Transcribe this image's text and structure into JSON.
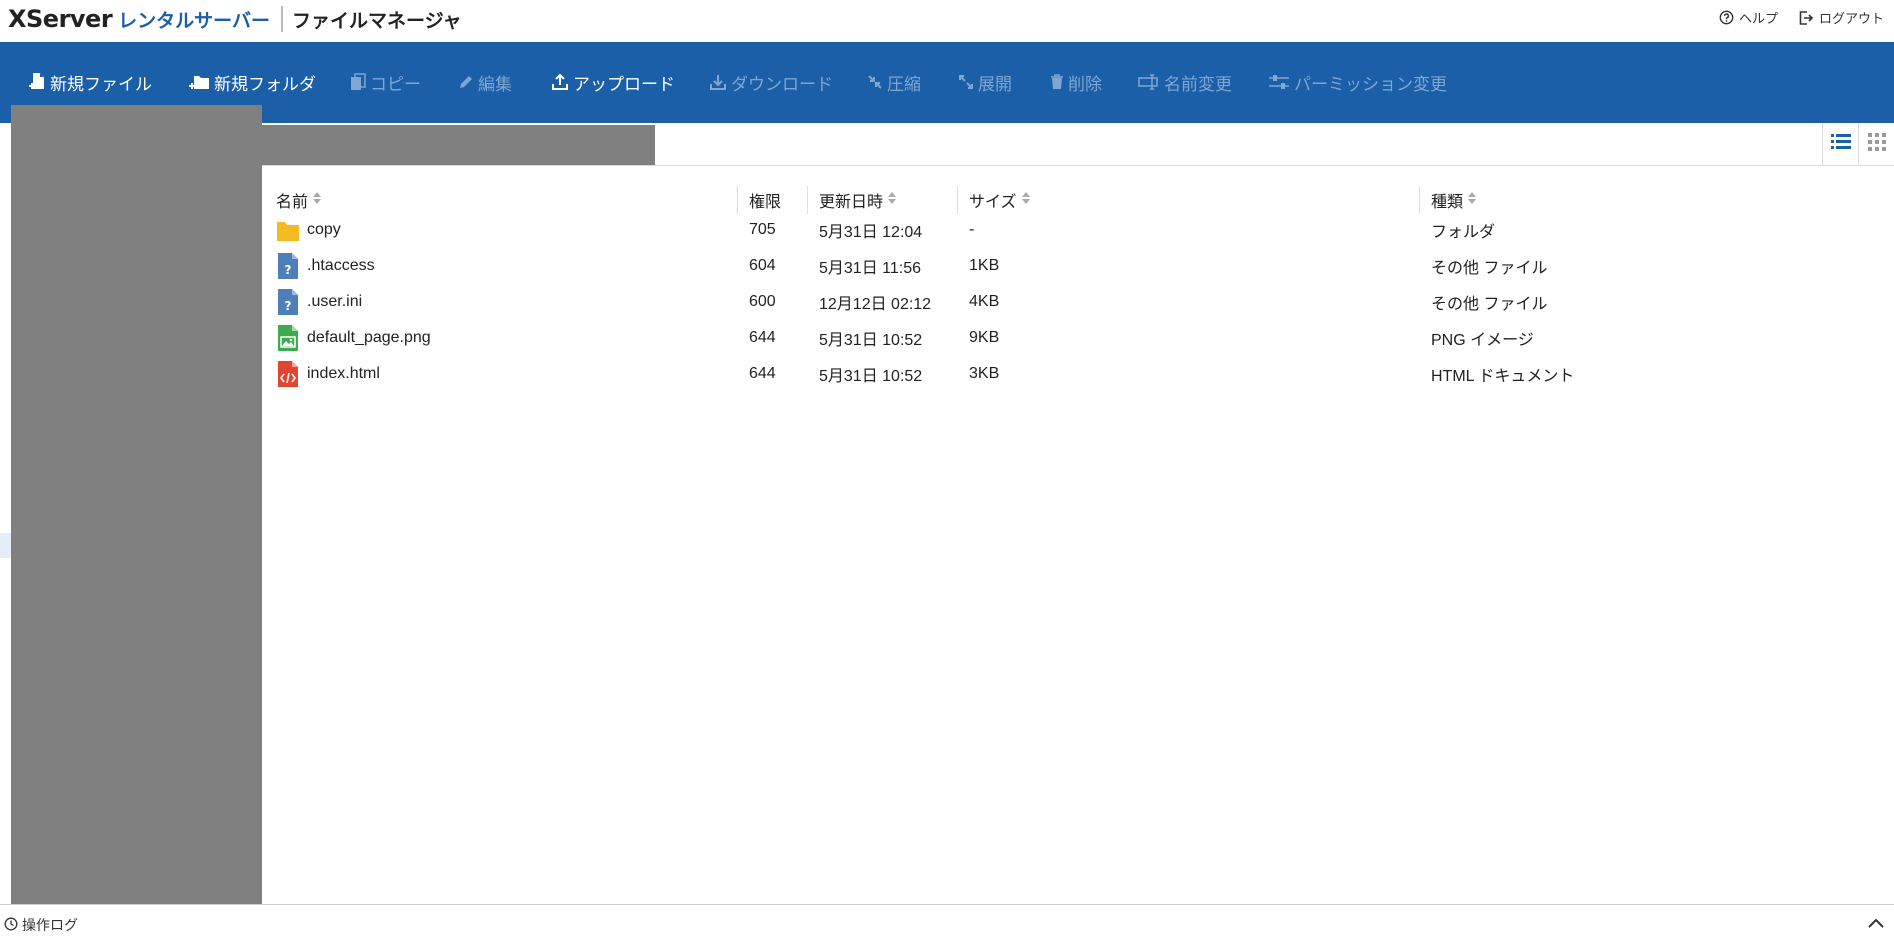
{
  "header": {
    "logo_main": "XServer",
    "logo_sub": "レンタルサーバー",
    "app_title": "ファイルマネージャ",
    "help_label": "ヘルプ",
    "logout_label": "ログアウト"
  },
  "toolbar": {
    "new_file": "新規ファイル",
    "new_folder": "新規フォルダ",
    "copy": "コピー",
    "edit": "編集",
    "upload": "アップロード",
    "download": "ダウンロード",
    "compress": "圧縮",
    "extract": "展開",
    "delete": "削除",
    "rename": "名前変更",
    "permission": "パーミッション変更"
  },
  "table": {
    "headers": {
      "name": "名前",
      "permission": "権限",
      "modified": "更新日時",
      "size": "サイズ",
      "type": "種類"
    },
    "rows": [
      {
        "name": "copy",
        "icon": "folder-icon",
        "permission": "705",
        "modified": "5月31日 12:04",
        "size": "-",
        "type": "フォルダ"
      },
      {
        "name": ".htaccess",
        "icon": "unknown-file-icon",
        "permission": "604",
        "modified": "5月31日 11:56",
        "size": "1KB",
        "type": "その他 ファイル"
      },
      {
        "name": ".user.ini",
        "icon": "unknown-file-icon",
        "permission": "600",
        "modified": "12月12日 02:12",
        "size": "4KB",
        "type": "その他 ファイル"
      },
      {
        "name": "default_page.png",
        "icon": "image-file-icon",
        "permission": "644",
        "modified": "5月31日 10:52",
        "size": "9KB",
        "type": "PNG イメージ"
      },
      {
        "name": "index.html",
        "icon": "html-file-icon",
        "permission": "644",
        "modified": "5月31日 10:52",
        "size": "3KB",
        "type": "HTML ドキュメント"
      }
    ]
  },
  "footer": {
    "oplog_label": "操作ログ"
  },
  "colors": {
    "brand_blue": "#1a5fa8",
    "toolbar_disabled": "#7fa6d1",
    "folder": "#f6b91f",
    "unknown_file": "#4f7fb8",
    "image_file": "#3daa4e",
    "html_file": "#e0452f"
  }
}
